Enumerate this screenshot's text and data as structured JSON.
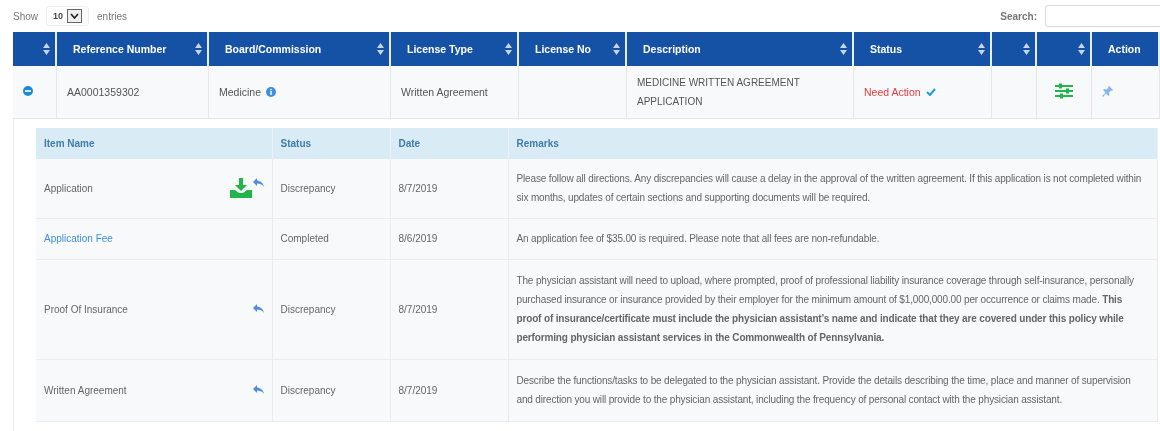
{
  "length_control": {
    "label_before": "Show",
    "value": "10",
    "label_after": "entries"
  },
  "search": {
    "label": "Search:"
  },
  "table": {
    "columns": [
      {
        "sortable": true
      },
      {
        "label": "Reference Number",
        "sortable": true
      },
      {
        "label": "Board/Commission",
        "sortable": true
      },
      {
        "label": "License Type",
        "sortable": true
      },
      {
        "label": "License No",
        "sortable": true
      },
      {
        "label": "Description",
        "sortable": true
      },
      {
        "label": "Status",
        "sortable": true
      },
      {
        "sortable": true
      },
      {
        "sortable": true
      },
      {
        "label": "Action",
        "sortable": false
      }
    ],
    "rows": [
      {
        "expanded": true,
        "reference_number": "AA0001359302",
        "board": "Medicine",
        "license_type": "Written Agreement",
        "description": "MEDICINE WRITTEN AGREEMENT APPLICATION",
        "status": "Need Action",
        "details": {
          "columns": [
            "Item Name",
            "Status",
            "Date",
            "Remarks"
          ],
          "rows": [
            {
              "item_name": "Application",
              "kind": "text",
              "downloadable": true,
              "returnable": true,
              "status": "Discrepancy",
              "date": "8/7/2019",
              "remarks": "Please follow all directions.  Any discrepancies will cause a delay in the approval of the written agreement.  If this application is not completed within six months, updates of certain sections and supporting documents will be required."
            },
            {
              "item_name": "Application Fee",
              "kind": "link",
              "downloadable": false,
              "returnable": false,
              "status": "Completed",
              "date": "8/6/2019",
              "remarks": "An application fee of $35.00 is required. Please note that all fees are non-refundable."
            },
            {
              "item_name": "Proof Of Insurance",
              "kind": "text",
              "downloadable": false,
              "returnable": true,
              "status": "Discrepancy",
              "date": "8/7/2019",
              "remarks": "The physician assistant will need to upload, where prompted, proof of professional liability insurance coverage through self-insurance, personally purchased insurance or insurance provided by their employer for the minimum amount of $1,000,000.00 per occurrence or claims made.  **This proof of insurance/certificate must include the physician assistant’s  name and indicate that they are covered under this policy while performing physician assistant services in the Commonwealth of Pennsylvania.**"
            },
            {
              "item_name": "Written Agreement",
              "kind": "text",
              "downloadable": false,
              "returnable": true,
              "status": "Discrepancy",
              "date": "8/7/2019",
              "remarks": "Describe the functions/tasks to be delegated to the physician assistant. Provide the details describing the time, place and manner of supervision and direction you will provide to the physician assistant, including the frequency of personal contact with the physician assistant."
            }
          ]
        }
      }
    ]
  }
}
